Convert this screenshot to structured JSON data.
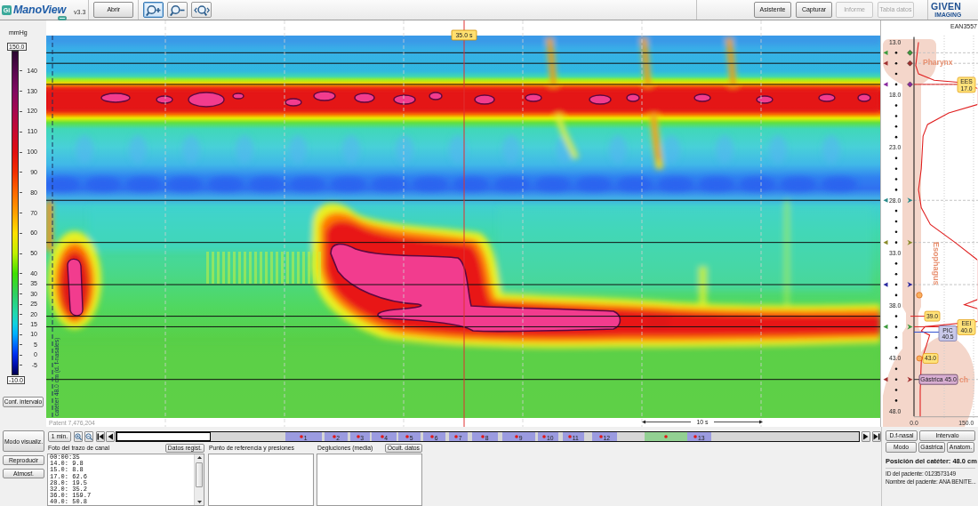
{
  "toolbar": {
    "logo_mark": "Gi",
    "app_name": "ManoView",
    "version": "v3.3",
    "open_button": "Abrir",
    "zoom_tools": [
      {
        "kind": "zoom-in",
        "selected": true
      },
      {
        "kind": "zoom-out",
        "selected": false
      },
      {
        "kind": "zoom-fit",
        "selected": false
      }
    ],
    "actions": [
      {
        "label": "Asistente",
        "disabled": false
      },
      {
        "label": "Capturar",
        "disabled": false
      },
      {
        "label": "Informe",
        "disabled": true
      },
      {
        "label": "Tabla datos",
        "disabled": true
      }
    ],
    "brand": {
      "name": "GIVEN",
      "tagline": "IMAGING"
    }
  },
  "color_scale": {
    "unit": "mmHg",
    "max": "150.0",
    "ticks": [
      "140",
      "130",
      "120",
      "110",
      "100",
      "90",
      "80",
      "70",
      "60",
      "50",
      "40",
      "35",
      "30",
      "25",
      "20",
      "15",
      "10",
      "5",
      "0",
      "-5"
    ],
    "min": "-10.0",
    "button": "Conf. intervalo"
  },
  "topography": {
    "cursor_label": "35.0 s",
    "catheter_label": "catéter 48.0 cm (d. f-nasales)",
    "footnote": "Patent 7,476,204",
    "scale_bar": "10 s"
  },
  "anatomy": {
    "catheter_id": "EAN3557",
    "rows": [
      {
        "kind": "major"
      },
      {
        "kind": "dot",
        "channel": {
          "kind": "diamond",
          "color": "#3c9a3c"
        }
      },
      {
        "kind": "dot",
        "channel": {
          "kind": "diamond",
          "color": "#a03030"
        }
      },
      {
        "kind": "dot"
      },
      {
        "kind": "dot",
        "channel": {
          "kind": "diamond",
          "color": "#8a2aa0"
        },
        "tags": [
          {
            "kind": "sphincter",
            "title": "EES",
            "value": "17.0"
          }
        ]
      },
      {
        "kind": "major"
      },
      {
        "kind": "dot"
      },
      {
        "kind": "dot"
      },
      {
        "kind": "dot"
      },
      {
        "kind": "dot"
      },
      {
        "kind": "major"
      },
      {
        "kind": "dot"
      },
      {
        "kind": "dot"
      },
      {
        "kind": "dot"
      },
      {
        "kind": "dot"
      },
      {
        "kind": "major",
        "channel": {
          "kind": "chevron",
          "color": "#2a8a8a"
        }
      },
      {
        "kind": "dot"
      },
      {
        "kind": "dot"
      },
      {
        "kind": "dot"
      },
      {
        "kind": "dot",
        "channel": {
          "kind": "chevron",
          "color": "#8a8a2a"
        }
      },
      {
        "kind": "major"
      },
      {
        "kind": "dot"
      },
      {
        "kind": "dot"
      },
      {
        "kind": "dot",
        "channel": {
          "kind": "chevron",
          "color": "#2a2aa0"
        }
      },
      {
        "kind": "dot",
        "tags": [
          {
            "kind": "point"
          }
        ]
      },
      {
        "kind": "major"
      },
      {
        "kind": "dot",
        "tags": [
          {
            "kind": "boundary",
            "value": "39.0"
          }
        ]
      },
      {
        "kind": "dot",
        "channel": {
          "kind": "chevron",
          "color": "#3c9a3c"
        },
        "tags": [
          {
            "kind": "sphincter",
            "title": "EEI",
            "value": "40.0"
          },
          {
            "kind": "pic",
            "title": "PIC",
            "value": "40.5"
          }
        ]
      },
      {
        "kind": "dot"
      },
      {
        "kind": "dot"
      },
      {
        "kind": "major",
        "tags": [
          {
            "kind": "boundary-point",
            "value": "43.0"
          }
        ]
      },
      {
        "kind": "dot"
      },
      {
        "kind": "dot",
        "channel": {
          "kind": "chevron",
          "color": "#a03030"
        },
        "tags": [
          {
            "kind": "gastric",
            "value": "Gástrica 45.0"
          }
        ]
      },
      {
        "kind": "dot"
      },
      {
        "kind": "dot"
      },
      {
        "kind": "major"
      }
    ],
    "regions": [
      {
        "kind": "pharynx",
        "label": "Pharynx"
      },
      {
        "kind": "esophagus",
        "label": "Esophagus"
      },
      {
        "kind": "stomach",
        "label": "ch"
      }
    ],
    "chart_data": {
      "type": "line",
      "orientation": "horizontal",
      "x": [
        13.0,
        15.2,
        16.0,
        16.6,
        16.8,
        17.4,
        18.9,
        19.7,
        20.8,
        21.9,
        25.0,
        27.0,
        28.7,
        30.3,
        32.0,
        33.7,
        37.4,
        37.9,
        38.3,
        39.5,
        40.0,
        40.4,
        40.8,
        43.3,
        46.1,
        48.5
      ],
      "series": [
        {
          "color": "#e02020",
          "values": [
            13,
            5,
            13,
            58,
            126,
            184,
            184,
            100,
            39,
            26,
            21,
            13,
            21,
            47,
            118,
            184,
            184,
            145,
            184,
            184,
            32,
            21,
            45,
            21,
            18,
            18
          ]
        }
      ],
      "xlim": [
        0,
        184
      ],
      "ylim": [
        48.5,
        12.5
      ],
      "xticks": [
        {
          "value": 0,
          "label": "0.0"
        },
        {
          "value": 150,
          "label": "150.0"
        }
      ],
      "yticks": [
        {
          "value": 13,
          "label": "13.0"
        },
        {
          "value": 18,
          "label": "18.0"
        },
        {
          "value": 23,
          "label": "23.0"
        },
        {
          "value": 28,
          "label": "28.0"
        },
        {
          "value": 33,
          "label": "33.0"
        },
        {
          "value": 38,
          "label": "38.0"
        },
        {
          "value": 43,
          "label": "43.0"
        },
        {
          "value": 48,
          "label": "48.0"
        }
      ]
    }
  },
  "side_buttons": [
    "Modo visualiz.",
    "Reproducir",
    "Atmosf."
  ],
  "timeline": {
    "window_button": "1 min.",
    "segments": [
      {
        "kind": "swallow",
        "label": "1"
      },
      {
        "kind": "swallow",
        "label": "2"
      },
      {
        "kind": "swallow",
        "label": "3"
      },
      {
        "kind": "swallow",
        "label": "4"
      },
      {
        "kind": "swallow",
        "label": "5"
      },
      {
        "kind": "swallow",
        "label": "6"
      },
      {
        "kind": "swallow",
        "label": "7"
      },
      {
        "kind": "swallow",
        "label": "8"
      },
      {
        "kind": "swallow",
        "label": "9"
      },
      {
        "kind": "swallow",
        "label": "10"
      },
      {
        "kind": "swallow",
        "label": "11"
      },
      {
        "kind": "swallow",
        "label": "12"
      },
      {
        "kind": "event"
      },
      {
        "kind": "swallow",
        "label": "13"
      }
    ]
  },
  "panels": [
    {
      "title": "Foto del trazo de canal",
      "button": "Datos regist.",
      "lines": [
        "00:00:35",
        "14.0: 9.8",
        "15.0: 8.8",
        "17.0: 62.6",
        "28.0: 19.5",
        "32.0: 35.2",
        "36.0: 159.7",
        "40.0: 50.8"
      ]
    },
    {
      "title": "Punto de referencia y presiones"
    },
    {
      "title": "Degluciones (media)",
      "button": "Ocult. datos"
    }
  ],
  "catheter_panel": {
    "button_rows": [
      [
        "D.f-nasal",
        "Intervalo"
      ],
      [
        "Modo",
        "Gástrica",
        "Anatom."
      ]
    ],
    "position": "Posición del catéter: 48.0 cm",
    "patient_id": "ID del paciente: 0123573149",
    "patient_name": "Nombre del paciente: ANA BENITE..."
  }
}
